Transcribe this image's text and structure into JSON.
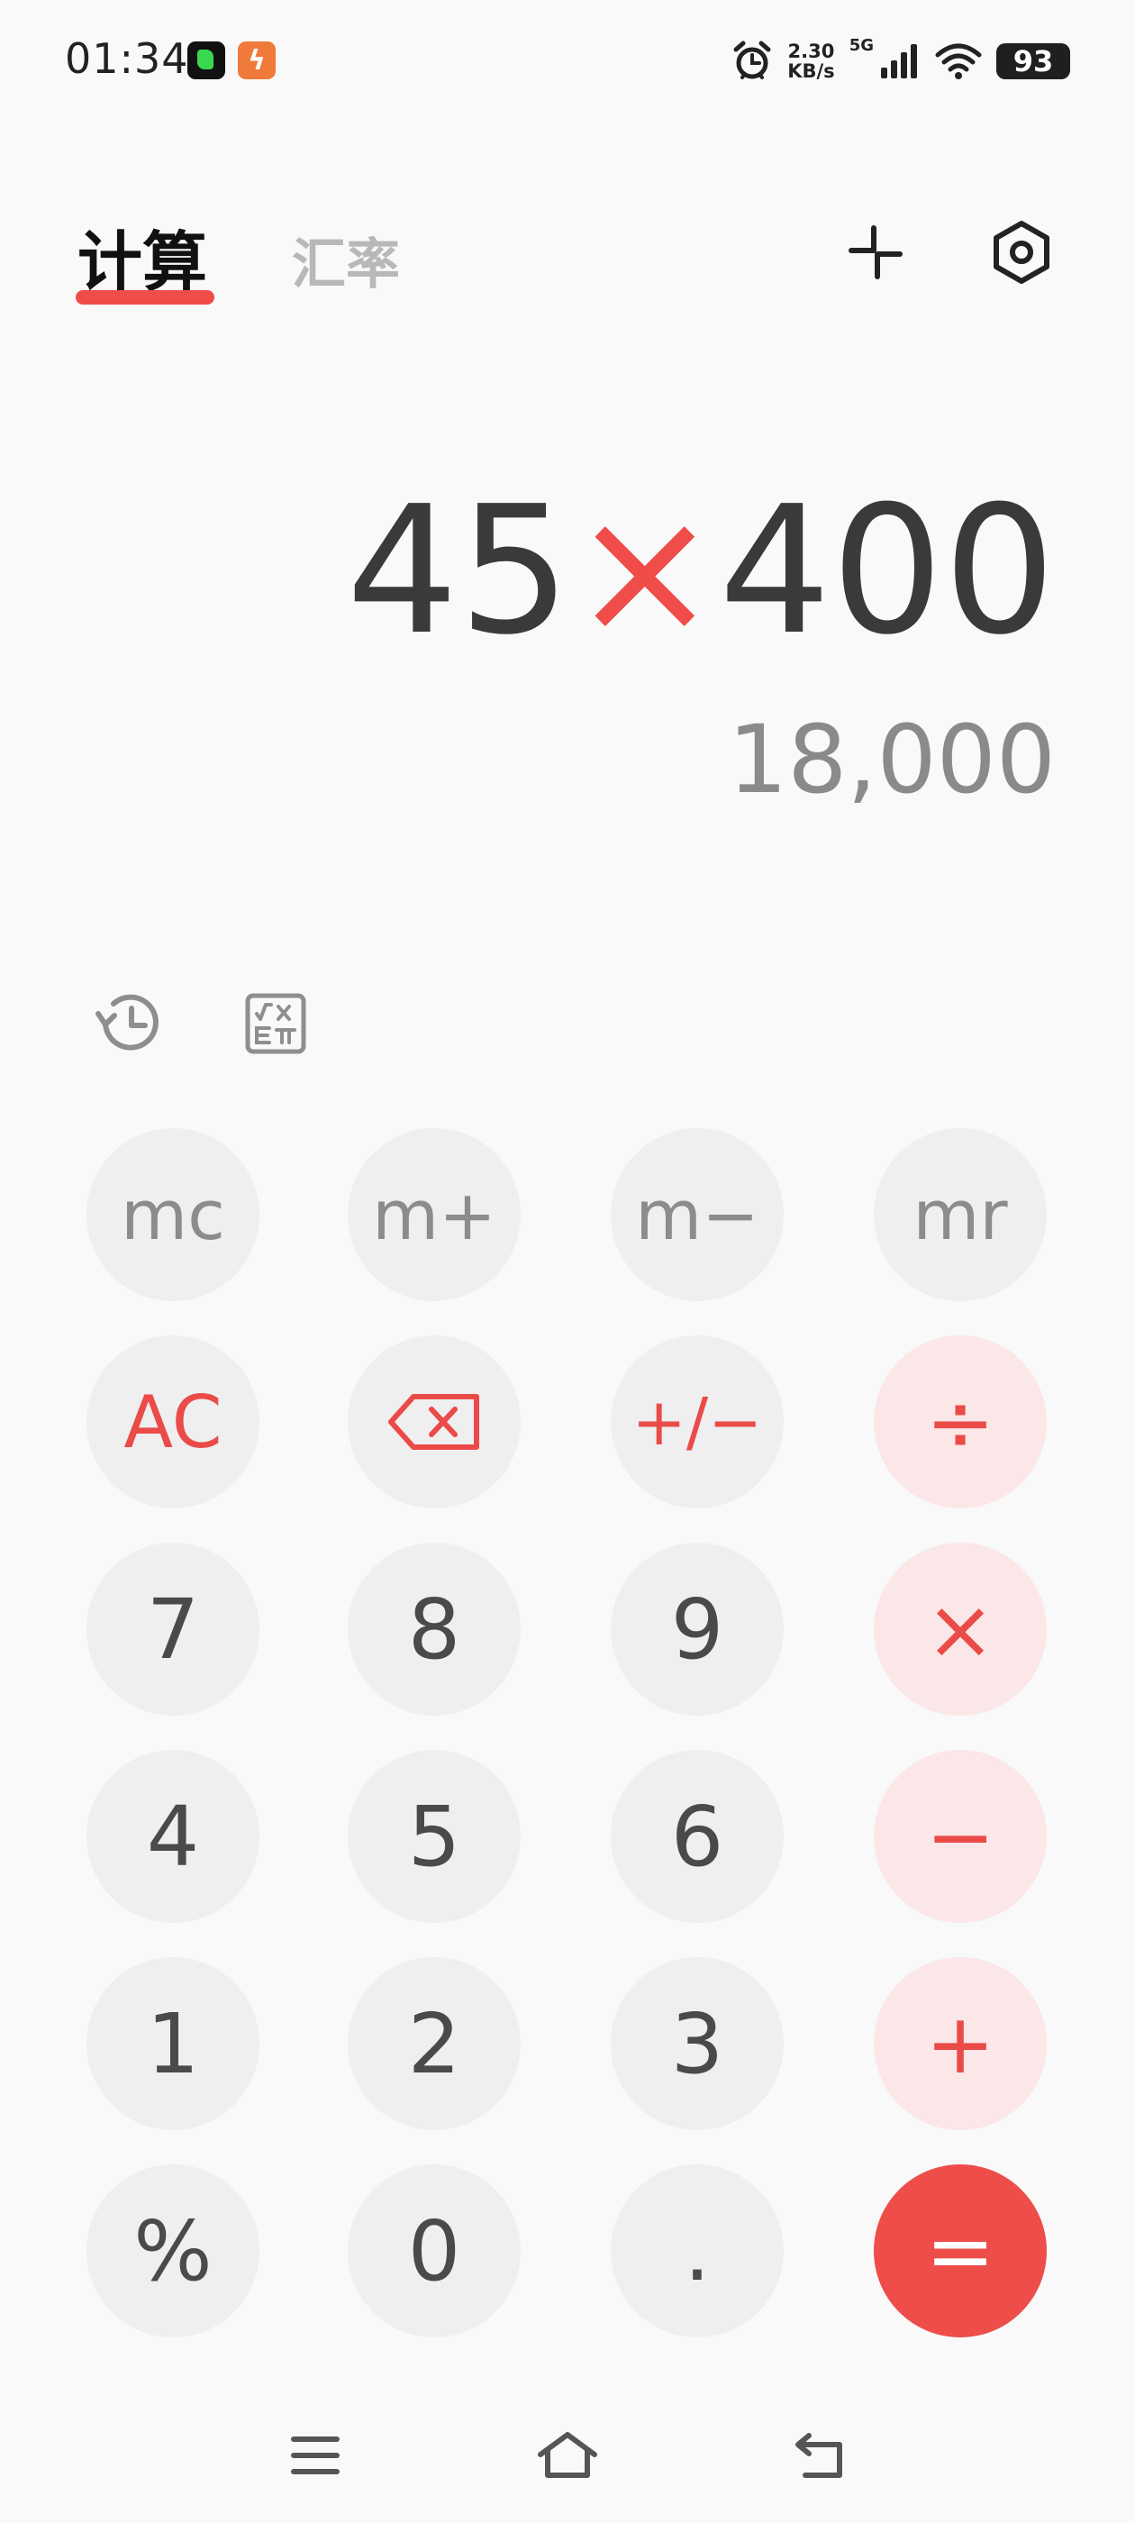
{
  "status_bar": {
    "time": "01:34",
    "net_speed_value": "2.30",
    "net_speed_unit": "KB/s",
    "signal_label": "5G",
    "battery": "93"
  },
  "header": {
    "tabs": [
      {
        "label": "计算",
        "active": true
      },
      {
        "label": "汇率",
        "active": false
      }
    ]
  },
  "display": {
    "expression_left": "45",
    "expression_operator": "×",
    "expression_right": "400",
    "result": "18,000"
  },
  "keypad": {
    "memory": [
      "mc",
      "m+",
      "m−",
      "mr"
    ],
    "row2": [
      "AC",
      "+/−",
      "÷"
    ],
    "row3": [
      "7",
      "8",
      "9",
      "×"
    ],
    "row4": [
      "4",
      "5",
      "6",
      "−"
    ],
    "row5": [
      "1",
      "2",
      "3",
      "+"
    ],
    "row6": [
      "%",
      "0",
      ".",
      "="
    ]
  },
  "colors": {
    "accent": "#ef4c4a",
    "key_bg": "#efefef",
    "operator_key_bg": "#fbe7e7"
  }
}
